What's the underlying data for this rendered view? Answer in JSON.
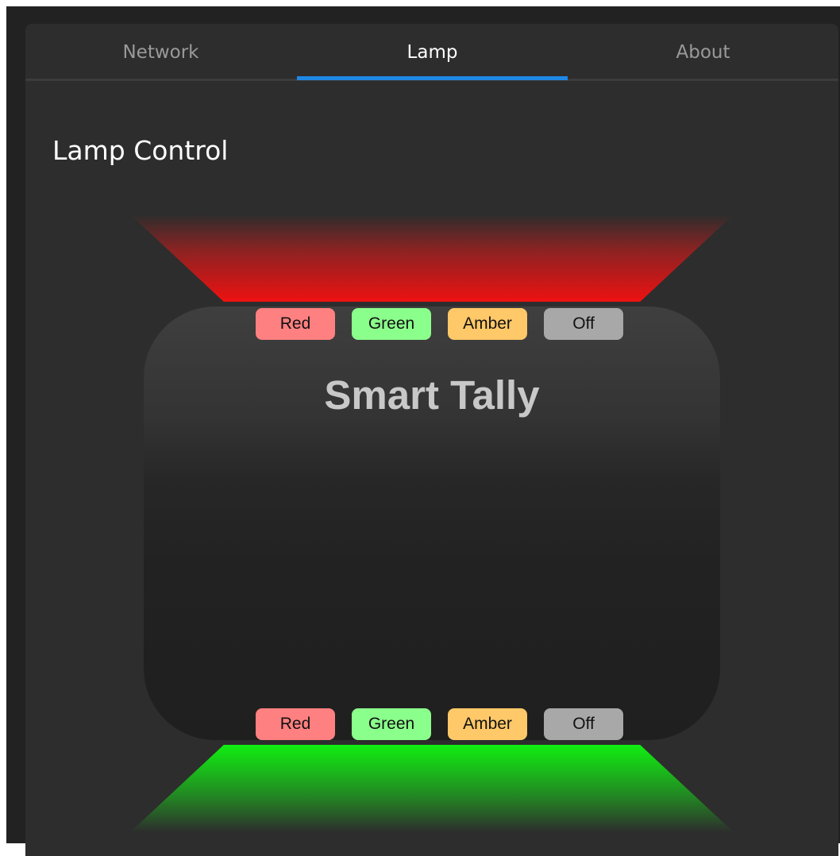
{
  "tabs": [
    {
      "label": "Network",
      "active": false
    },
    {
      "label": "Lamp",
      "active": true
    },
    {
      "label": "About",
      "active": false
    }
  ],
  "page": {
    "title": "Lamp Control"
  },
  "device": {
    "title": "Smart Tally"
  },
  "colors": {
    "accent": "#1e88e5",
    "top_lamp": "#ee1111",
    "bottom_lamp": "#11ee11",
    "btn_red": "#ff8080",
    "btn_green": "#8bff8b",
    "btn_amber": "#ffc868",
    "btn_off": "#a8a8a8"
  },
  "top_controls": {
    "lamp_state": "Red",
    "buttons": [
      {
        "label": "Red"
      },
      {
        "label": "Green"
      },
      {
        "label": "Amber"
      },
      {
        "label": "Off"
      }
    ]
  },
  "bottom_controls": {
    "lamp_state": "Green",
    "buttons": [
      {
        "label": "Red"
      },
      {
        "label": "Green"
      },
      {
        "label": "Amber"
      },
      {
        "label": "Off"
      }
    ]
  }
}
